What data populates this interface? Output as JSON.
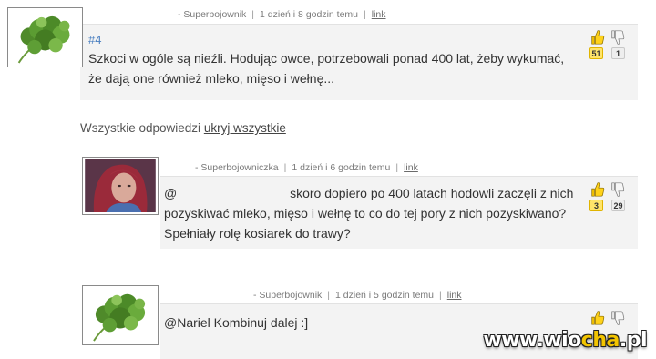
{
  "comments": [
    {
      "author": "- Superbojownik",
      "time": "1 dzień i 8 godzin temu",
      "link": "link",
      "number": "#4",
      "lines": [
        "Szkoci w ogóle są nieźli. Hodując owce, potrzebowali ponad 400 lat, żeby wykumać,",
        "że dają one również mleko, mięso i wełnę..."
      ],
      "votes_up": "51",
      "votes_down": "1"
    },
    {
      "author": "- Superbojowniczka",
      "time": "1 dzień i 6 godzin temu",
      "link": "link",
      "mention": "@",
      "lines": [
        "skoro dopiero po 400 latach hodowli zaczęli z nich",
        "pozyskiwać mleko, mięso i wełnę to co do tej pory z nich pozyskiwano?",
        "Spełniały rolę kosiarek do trawy?"
      ],
      "votes_up": "3",
      "votes_down": "29"
    },
    {
      "author": "- Superbojownik",
      "time": "1 dzień i 5 godzin temu",
      "link": "link",
      "lines": [
        "@Nariel Kombinuj dalej :]"
      ]
    }
  ],
  "replies": {
    "label": "Wszystkie odpowiedzi",
    "hide_all": "ukryj wszystkie"
  },
  "watermark": {
    "prefix": "www.wio",
    "accent": "cha",
    "suffix": ".pl"
  },
  "colors": {
    "up_badge": "#ffe46a",
    "link_blue": "#4a7fc0",
    "box_bg": "#f3f3f3"
  },
  "icons": {
    "thumbs_up": "thumbs-up-icon",
    "thumbs_down": "thumbs-down-icon"
  }
}
